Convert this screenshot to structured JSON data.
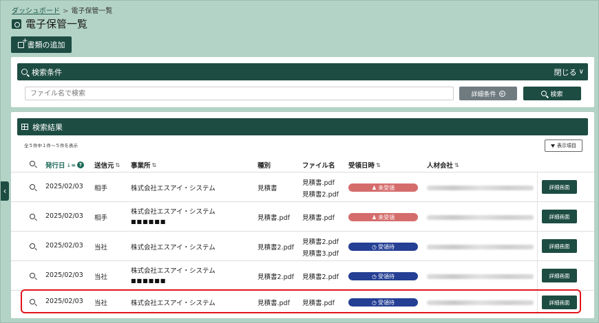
{
  "breadcrumb": {
    "home": "ダッシュボード",
    "separator": ">",
    "current": "電子保管一覧"
  },
  "page": {
    "title": "電子保管一覧",
    "add_button": "書類の追加"
  },
  "search_panel": {
    "title": "検索条件",
    "collapse_label": "閉じる",
    "input_placeholder": "ファイル名で検索",
    "detail_conditions_button": "詳細条件",
    "search_button": "検索"
  },
  "results_panel": {
    "title": "検索結果",
    "count_text": "全５件中１件～５件を表示",
    "display_columns_button": "表示項目",
    "columns": {
      "issue_date": "発行日",
      "sender": "送信元",
      "office": "事業所",
      "type": "種別",
      "filename": "ファイル名",
      "received_at": "受領日時",
      "staffing_company": "人材会社"
    },
    "rows": [
      {
        "date": "2025/02/03",
        "sender": "相手",
        "office": "株式会社エスアイ・システム",
        "office_line2": "",
        "type": "見積書",
        "file1": "見積書.pdf",
        "file2": "見積書2.pdf",
        "status": "未受領",
        "status_kind": "unrecv",
        "detail": "詳細画面"
      },
      {
        "date": "2025/02/03",
        "sender": "相手",
        "office": "株式会社エスアイ・システム",
        "office_line2": "■■■■■■",
        "type": "見積書.pdf",
        "file1": "見積書.pdf",
        "file2": "",
        "status": "未受領",
        "status_kind": "unrecv",
        "detail": "詳細画面"
      },
      {
        "date": "2025/02/03",
        "sender": "当社",
        "office": "株式会社エスアイ・システム",
        "office_line2": "",
        "type": "見積書2.pdf",
        "file1": "見積書2.pdf",
        "file2": "見積書3.pdf",
        "status": "受領待",
        "status_kind": "waiting",
        "detail": "詳細画面"
      },
      {
        "date": "2025/02/03",
        "sender": "当社",
        "office": "株式会社エスアイ・システム",
        "office_line2": "■■■■■■",
        "type": "見積書2.pdf",
        "file1": "見積書2.pdf",
        "file2": "",
        "status": "受領待",
        "status_kind": "waiting",
        "detail": "詳細画面"
      },
      {
        "date": "2025/02/03",
        "sender": "当社",
        "office": "株式会社エスアイ・システム",
        "office_line2": "",
        "type": "見積書.pdf",
        "file1": "見積書.pdf",
        "file2": "",
        "status": "受領待",
        "status_kind": "waiting",
        "detail": "詳細画面"
      }
    ]
  },
  "colors": {
    "primary": "#1d4c42",
    "background": "#b3d3c6",
    "unreceived": "#d56c6c",
    "waiting": "#243f94",
    "highlight": "#e0141a"
  }
}
